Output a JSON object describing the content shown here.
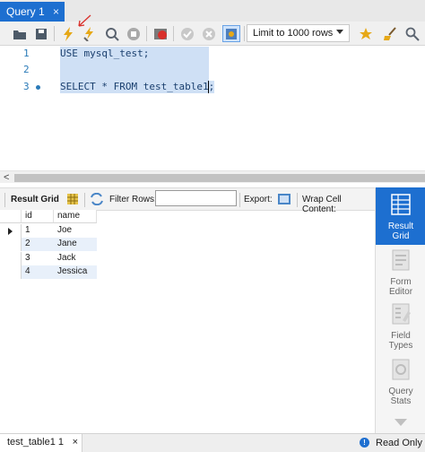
{
  "tab": {
    "title": "Query 1",
    "close": "×"
  },
  "toolbar": {
    "limit_value": "Limit to 1000 rows"
  },
  "editor": {
    "lines": [
      {
        "number": "1",
        "code": "USE mysql_test;"
      },
      {
        "number": "2",
        "code": ""
      },
      {
        "number": "3",
        "code": "SELECT * FROM test_table1;"
      }
    ]
  },
  "scrollbar": {
    "left_arrow": "<"
  },
  "results_toolbar": {
    "result_grid": "Result Grid",
    "filter_rows": "Filter Rows:",
    "export": "Export:",
    "wrap_cell": "Wrap Cell Content:"
  },
  "grid": {
    "columns": [
      "id",
      "name"
    ],
    "rows": [
      {
        "id": "1",
        "name": "Joe"
      },
      {
        "id": "2",
        "name": "Jane"
      },
      {
        "id": "3",
        "name": "Jack"
      },
      {
        "id": "4",
        "name": "Jessica"
      }
    ]
  },
  "right_panel": [
    {
      "label_1": "Result",
      "label_2": "Grid"
    },
    {
      "label_1": "Form",
      "label_2": "Editor"
    },
    {
      "label_1": "Field",
      "label_2": "Types"
    },
    {
      "label_1": "Query",
      "label_2": "Stats"
    }
  ],
  "bottom": {
    "tab_label": "test_table1 1",
    "close": "×",
    "status": "Read Only",
    "info_glyph": "!"
  },
  "colors": {
    "accent": "#1d6fd0",
    "selection": "#cfe0f5",
    "code": "#1a3f6e"
  }
}
